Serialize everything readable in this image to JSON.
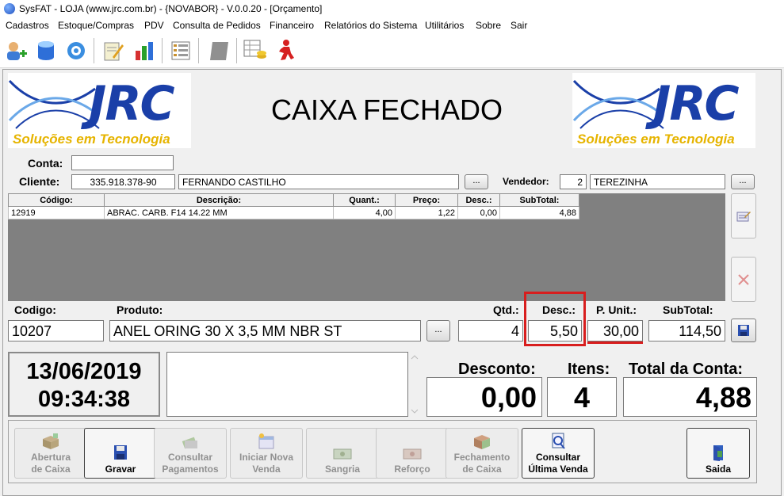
{
  "window": {
    "title": "SysFAT - LOJA (www.jrc.com.br) - {NOVABOR} - V.0.0.20 - [Orçamento]"
  },
  "menu": [
    "Cadastros",
    "Estoque/Compras",
    "PDV",
    "Consulta de Pedidos",
    "Financeiro",
    "Relatórios do Sistema",
    "Utilitários",
    "Sobre",
    "Sair"
  ],
  "toolbar_icons": [
    "add-user-icon",
    "database-icon",
    "gear-icon",
    "notepad-pencil-icon",
    "bar-chart-icon",
    "list-icon",
    "disabled-square-icon",
    "spreadsheet-coins-icon",
    "running-man-icon"
  ],
  "logo": {
    "name": "JRC",
    "tagline": "Soluções em Tecnologia"
  },
  "caixa_status": "CAIXA FECHADO",
  "form": {
    "conta_label": "Conta:",
    "conta_value": "",
    "cliente_label": "Cliente:",
    "cliente_code": "335.918.378-90",
    "cliente_name": "FERNANDO CASTILHO",
    "vendedor_label": "Vendedor:",
    "vendedor_code": "2",
    "vendedor_name": "TEREZINHA",
    "ellipsis": "..."
  },
  "grid": {
    "headers": [
      "Código:",
      "Descrição:",
      "Quant.:",
      "Preço:",
      "Desc.:",
      "SubTotal:"
    ],
    "rows": [
      [
        "12919",
        "ABRAC. CARB. F14 14.22 MM",
        "4,00",
        "1,22",
        "0,00",
        "4,88"
      ]
    ]
  },
  "entry": {
    "codigo_label": "Codigo:",
    "produto_label": "Produto:",
    "qtd_label": "Qtd.:",
    "desc_label": "Desc.:",
    "punit_label": "P. Unit.:",
    "subtotal_label": "SubTotal:",
    "codigo": "10207",
    "produto": "ANEL ORING 30 X 3,5 MM NBR ST",
    "qtd": "4",
    "desc": "5,50",
    "punit": "30,00",
    "subtotal": "114,50"
  },
  "clock": {
    "date": "13/06/2019",
    "time": "09:34:38"
  },
  "summary": {
    "desconto_label": "Desconto:",
    "desconto": "0,00",
    "itens_label": "Itens:",
    "itens": "4",
    "total_label": "Total da Conta:",
    "total": "4,88"
  },
  "actions": [
    {
      "label1": "Abertura",
      "label2": "de Caixa",
      "enabled": false
    },
    {
      "label1": "Gravar",
      "label2": "",
      "enabled": true
    },
    {
      "label1": "Consultar",
      "label2": "Pagamentos",
      "enabled": false
    },
    {
      "label1": "Iniciar Nova",
      "label2": "Venda",
      "enabled": false
    },
    {
      "label1": "Sangria",
      "label2": "",
      "enabled": false
    },
    {
      "label1": "Reforço",
      "label2": "",
      "enabled": false
    },
    {
      "label1": "Fechamento",
      "label2": "de Caixa",
      "enabled": false
    },
    {
      "label1": "Consultar",
      "label2": "Última Venda",
      "enabled": true
    },
    {
      "label1": "Saida",
      "label2": "",
      "enabled": true
    }
  ],
  "colors": {
    "highlight": "#d81e1e",
    "logo_blue": "#1a3fa8",
    "logo_yellow": "#e6b400",
    "grid_bg": "#808080"
  }
}
